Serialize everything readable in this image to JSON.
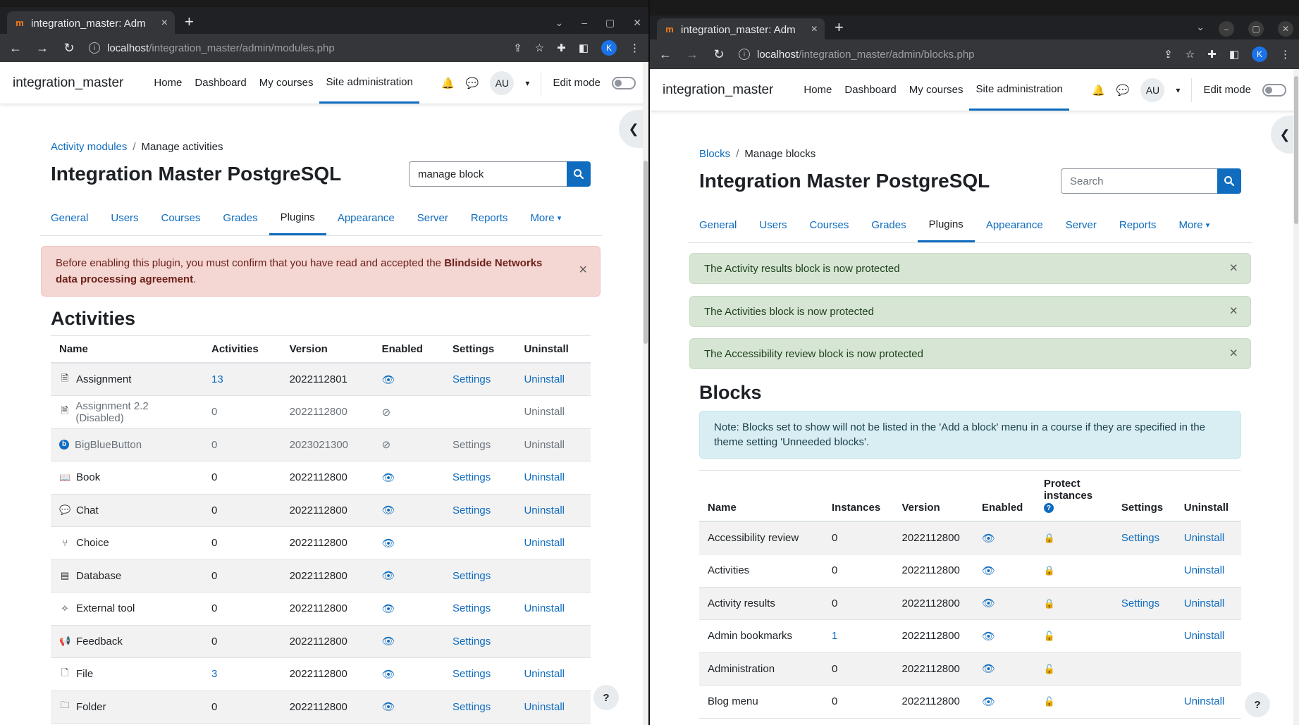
{
  "left": {
    "tab_title": "integration_master: Adm",
    "url_host": "localhost",
    "url_path": "/integration_master/admin/modules.php",
    "brand": "integration_master",
    "nav": [
      "Home",
      "Dashboard",
      "My courses",
      "Site administration"
    ],
    "avatar": "AU",
    "edit_mode": "Edit mode",
    "profile_initial": "K",
    "breadcrumb_link": "Activity modules",
    "breadcrumb_current": "Manage activities",
    "title": "Integration Master PostgreSQL",
    "search_value": "manage block",
    "secnav": [
      "General",
      "Users",
      "Courses",
      "Grades",
      "Plugins",
      "Appearance",
      "Server",
      "Reports",
      "More"
    ],
    "alert_text_before": "Before enabling this plugin, you must confirm that you have read and accepted the ",
    "alert_text_bold": "Blindside Networks data processing agreement",
    "alert_text_after": ".",
    "section_title": "Activities",
    "columns": [
      "Name",
      "Activities",
      "Version",
      "Enabled",
      "Settings",
      "Uninstall"
    ],
    "rows": [
      {
        "icon": "assignment-icon",
        "glyph": "🗎",
        "name": "Assignment",
        "count": "13",
        "version": "2022112801",
        "enabled": true,
        "settings": "Settings",
        "uninstall": "Uninstall",
        "dim": false,
        "countlink": true
      },
      {
        "icon": "assignment-icon",
        "glyph": "🗎",
        "name": "Assignment 2.2 (Disabled)",
        "count": "0",
        "version": "2022112800",
        "enabled": false,
        "settings": "",
        "uninstall": "Uninstall",
        "dim": true,
        "countlink": false
      },
      {
        "icon": "bigbluebutton-icon",
        "glyph": "b",
        "name": "BigBlueButton",
        "count": "0",
        "version": "2023021300",
        "enabled": false,
        "settings": "Settings",
        "uninstall": "Uninstall",
        "dim": true,
        "countlink": false
      },
      {
        "icon": "book-icon",
        "glyph": "📖",
        "name": "Book",
        "count": "0",
        "version": "2022112800",
        "enabled": true,
        "settings": "Settings",
        "uninstall": "Uninstall",
        "dim": false,
        "countlink": false
      },
      {
        "icon": "chat-icon",
        "glyph": "💬",
        "name": "Chat",
        "count": "0",
        "version": "2022112800",
        "enabled": true,
        "settings": "Settings",
        "uninstall": "Uninstall",
        "dim": false,
        "countlink": false
      },
      {
        "icon": "choice-icon",
        "glyph": "⑂",
        "name": "Choice",
        "count": "0",
        "version": "2022112800",
        "enabled": true,
        "settings": "",
        "uninstall": "Uninstall",
        "dim": false,
        "countlink": false
      },
      {
        "icon": "database-icon",
        "glyph": "▤",
        "name": "Database",
        "count": "0",
        "version": "2022112800",
        "enabled": true,
        "settings": "Settings",
        "uninstall": "",
        "dim": false,
        "countlink": false
      },
      {
        "icon": "external-tool-icon",
        "glyph": "✧",
        "name": "External tool",
        "count": "0",
        "version": "2022112800",
        "enabled": true,
        "settings": "Settings",
        "uninstall": "Uninstall",
        "dim": false,
        "countlink": false
      },
      {
        "icon": "feedback-icon",
        "glyph": "📢",
        "name": "Feedback",
        "count": "0",
        "version": "2022112800",
        "enabled": true,
        "settings": "Settings",
        "uninstall": "",
        "dim": false,
        "countlink": false
      },
      {
        "icon": "file-icon",
        "glyph": "🗋",
        "name": "File",
        "count": "3",
        "version": "2022112800",
        "enabled": true,
        "settings": "Settings",
        "uninstall": "Uninstall",
        "dim": false,
        "countlink": true
      },
      {
        "icon": "folder-icon",
        "glyph": "🗀",
        "name": "Folder",
        "count": "0",
        "version": "2022112800",
        "enabled": true,
        "settings": "Settings",
        "uninstall": "Uninstall",
        "dim": false,
        "countlink": false
      }
    ]
  },
  "right": {
    "tab_title": "integration_master: Adm",
    "url_host": "localhost",
    "url_path": "/integration_master/admin/blocks.php",
    "brand": "integration_master",
    "nav": [
      "Home",
      "Dashboard",
      "My courses",
      "Site administration"
    ],
    "avatar": "AU",
    "edit_mode": "Edit mode",
    "profile_initial": "K",
    "breadcrumb_link": "Blocks",
    "breadcrumb_current": "Manage blocks",
    "title": "Integration Master PostgreSQL",
    "search_placeholder": "Search",
    "secnav": [
      "General",
      "Users",
      "Courses",
      "Grades",
      "Plugins",
      "Appearance",
      "Server",
      "Reports",
      "More"
    ],
    "alerts": [
      "The Activity results block is now protected",
      "The Activities block is now protected",
      "The Accessibility review block is now protected"
    ],
    "section_title": "Blocks",
    "note": "Note: Blocks set to show will not be listed in the 'Add a block' menu in a course if they are specified in the theme setting 'Unneeded blocks'.",
    "columns": [
      "Name",
      "Instances",
      "Version",
      "Enabled",
      "Protect instances",
      "Settings",
      "Uninstall"
    ],
    "rows": [
      {
        "name": "Accessibility review",
        "count": "0",
        "version": "2022112800",
        "locked": true,
        "settings": "Settings",
        "uninstall": "Uninstall",
        "countlink": false
      },
      {
        "name": "Activities",
        "count": "0",
        "version": "2022112800",
        "locked": true,
        "settings": "",
        "uninstall": "Uninstall",
        "countlink": false
      },
      {
        "name": "Activity results",
        "count": "0",
        "version": "2022112800",
        "locked": true,
        "settings": "Settings",
        "uninstall": "Uninstall",
        "countlink": false
      },
      {
        "name": "Admin bookmarks",
        "count": "1",
        "version": "2022112800",
        "locked": false,
        "settings": "",
        "uninstall": "Uninstall",
        "countlink": true
      },
      {
        "name": "Administration",
        "count": "0",
        "version": "2022112800",
        "locked": false,
        "settings": "",
        "uninstall": "",
        "countlink": false
      },
      {
        "name": "Blog menu",
        "count": "0",
        "version": "2022112800",
        "locked": false,
        "settings": "",
        "uninstall": "Uninstall",
        "countlink": false
      }
    ]
  },
  "icons": {
    "eye": "👁",
    "eye_slash": "⊘",
    "lock": "🔒",
    "unlock": "🔓",
    "close": "×",
    "chevron_left": "‹",
    "help": "?",
    "new_tab": "+",
    "chevron_down": "⌄"
  },
  "colors": {
    "accent": "#0f6cbf",
    "danger_bg": "#f4d6d2",
    "success_bg": "#d7e6d4",
    "info_bg": "#d9eef3"
  }
}
